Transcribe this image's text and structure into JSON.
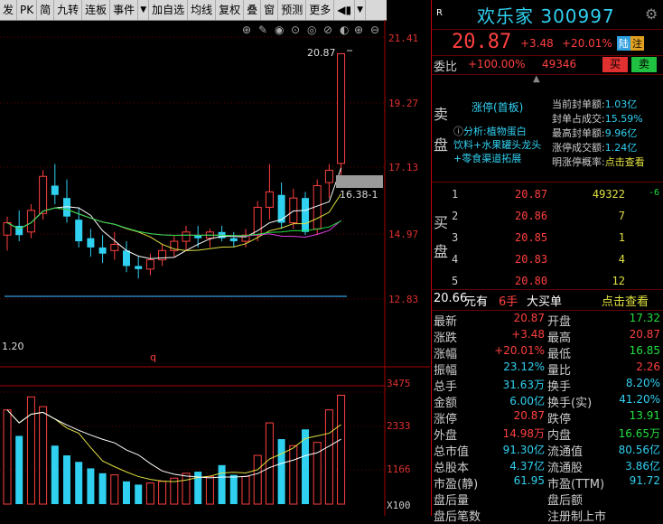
{
  "toolbar": {
    "items": [
      "发",
      "PK",
      "简",
      "九转",
      "连板",
      "事件",
      "▼",
      "加自选",
      "均线",
      "复权",
      "叠",
      "窗",
      "预测",
      "更多",
      "◀▮",
      "▼"
    ]
  },
  "chart": {
    "price_ticks": [
      "21.41",
      "19.27",
      "17.13",
      "14.97",
      "12.83"
    ],
    "volume_ticks": [
      "3475",
      "2333",
      "1166",
      "X100"
    ],
    "high_label": "20.87",
    "ref_label": "16.38-1",
    "low_label": "1.20",
    "marker": "q"
  },
  "chart_data": {
    "type": "candlestick",
    "price_axis": [
      "21.41",
      "19.27",
      "17.13",
      "14.97",
      "12.83"
    ],
    "volume_axis": [
      "3475",
      "2333",
      "1166"
    ],
    "ref_price": "16.38",
    "top_price": "20.87"
  },
  "stock": {
    "tag": "R",
    "name": "欢乐家",
    "code": "300997",
    "price": "20.87",
    "change": "+3.48",
    "pct": "+20.01%",
    "badge1": "陆",
    "badge2": "注"
  },
  "weibi": {
    "label": "委比",
    "pct": "+100.00%",
    "vol": "49346",
    "buy_btn": "买",
    "sell_btn": "卖"
  },
  "sell_side": {
    "label_top": "卖",
    "label_bottom": "盘",
    "status": "涨停(首板)",
    "analysis": "分析:植物蛋白饮料+水果罐头龙头+零食渠道拓展",
    "analysis_l1": "分析:植物蛋白",
    "analysis_l2": "饮料+水果罐头龙头",
    "analysis_l3": "+零食渠道拓展",
    "stats": [
      {
        "k": "当前封单额:",
        "v": "1.03亿"
      },
      {
        "k": "封单占成交:",
        "v": "15.59%"
      },
      {
        "k": "最高封单额:",
        "v": "9.96亿"
      },
      {
        "k": "涨停成交额:",
        "v": "1.24亿"
      },
      {
        "k": "明涨停概率:",
        "v": "点击查看"
      }
    ]
  },
  "buy_side": {
    "label_top": "买",
    "label_bottom": "盘",
    "rows": [
      {
        "n": "1",
        "p": "20.87",
        "v": "49322",
        "d": "-6"
      },
      {
        "n": "2",
        "p": "20.86",
        "v": "7",
        "d": ""
      },
      {
        "n": "3",
        "p": "20.85",
        "v": "1",
        "d": ""
      },
      {
        "n": "4",
        "p": "20.83",
        "v": "4",
        "d": ""
      },
      {
        "n": "5",
        "p": "20.80",
        "v": "12",
        "d": ""
      }
    ]
  },
  "big_order": {
    "price": "20.66",
    "unit": "元有",
    "hands": "6手",
    "text": "大买单",
    "link": "点击查看"
  },
  "quote": [
    {
      "k1": "最新",
      "v1": "20.87",
      "c1": "red",
      "k2": "开盘",
      "v2": "17.32",
      "c2": "grn"
    },
    {
      "k1": "涨跌",
      "v1": "+3.48",
      "c1": "red",
      "k2": "最高",
      "v2": "20.87",
      "c2": "red"
    },
    {
      "k1": "涨幅",
      "v1": "+20.01%",
      "c1": "red",
      "k2": "最低",
      "v2": "16.85",
      "c2": "grn"
    },
    {
      "k1": "振幅",
      "v1": "23.12%",
      "c1": "cyan",
      "k2": "量比",
      "v2": "2.26",
      "c2": "red"
    },
    {
      "k1": "总手",
      "v1": "31.63万",
      "c1": "cyan",
      "k2": "换手",
      "v2": "8.20%",
      "c2": "cyan"
    },
    {
      "k1": "金额",
      "v1": "6.00亿",
      "c1": "cyan",
      "k2": "换手(实)",
      "v2": "41.20%",
      "c2": "cyan"
    },
    {
      "k1": "涨停",
      "v1": "20.87",
      "c1": "red",
      "k2": "跌停",
      "v2": "13.91",
      "c2": "grn"
    },
    {
      "k1": "外盘",
      "v1": "14.98万",
      "c1": "red",
      "k2": "内盘",
      "v2": "16.65万",
      "c2": "grn"
    },
    {
      "k1": "总市值",
      "v1": "91.30亿",
      "c1": "cyan",
      "k2": "流通值",
      "v2": "80.56亿",
      "c2": "cyan"
    },
    {
      "k1": "总股本",
      "v1": "4.37亿",
      "c1": "cyan",
      "k2": "流通股",
      "v2": "3.86亿",
      "c2": "cyan"
    },
    {
      "k1": "市盈(静)",
      "v1": "61.95",
      "c1": "cyan",
      "k2": "市盈(TTM)",
      "v2": "91.72",
      "c2": "cyan"
    },
    {
      "k1": "盘后量",
      "v1": "",
      "c1": "cyan",
      "k2": "盘后额",
      "v2": "",
      "c2": "cyan"
    },
    {
      "k1": "盘后笔数",
      "v1": "",
      "c1": "cyan",
      "k2": "注册制上市",
      "v2": "",
      "c2": "cyan"
    }
  ],
  "colors": {
    "up": "#ff4040",
    "down": "#30d0f0",
    "accent_green": "#20e040",
    "bg": "#000000"
  }
}
